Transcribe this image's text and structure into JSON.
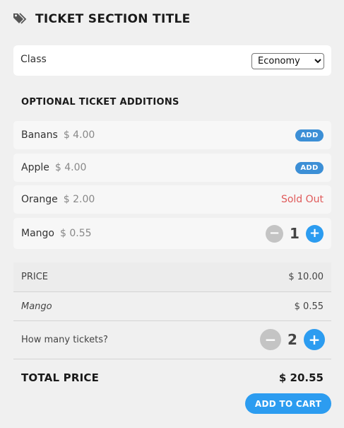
{
  "section": {
    "title": "TICKET SECTION TITLE",
    "icon": "tag-icon"
  },
  "class_selector": {
    "label": "Class",
    "selected": "Economy",
    "options": [
      "Economy"
    ]
  },
  "optional": {
    "heading": "OPTIONAL TICKET ADDITIONS",
    "items": [
      {
        "name": "Banans",
        "price": "$ 4.00",
        "action": "ADD"
      },
      {
        "name": "Apple",
        "price": "$ 4.00",
        "action": "ADD"
      },
      {
        "name": "Orange",
        "price": "$ 2.00",
        "status": "Sold Out"
      },
      {
        "name": "Mango",
        "price": "$ 0.55",
        "quantity": "1",
        "minus": "−",
        "plus": "+"
      }
    ]
  },
  "summary": {
    "price_label": "PRICE",
    "price_value": "$ 10.00",
    "addon_label": "Mango",
    "addon_value": "$ 0.55",
    "tickets_label": "How many tickets?",
    "tickets_quantity": "2",
    "minus": "−",
    "plus": "+",
    "total_label": "TOTAL PRICE",
    "total_value": "$ 20.55"
  },
  "cart_button": "ADD TO CART",
  "colors": {
    "accent": "#2c9cf0",
    "add_button": "#3c8fd6",
    "sold_out": "#e05a5a",
    "background": "#f0f0f0"
  }
}
